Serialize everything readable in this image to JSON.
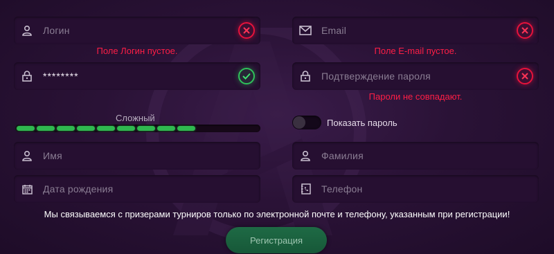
{
  "form": {
    "login": {
      "placeholder": "Логин",
      "error": "Поле Логин пустое."
    },
    "email": {
      "placeholder": "Email",
      "error": "Поле E-mail пустое."
    },
    "password": {
      "value": "********"
    },
    "password_confirm": {
      "placeholder": "Подтверждение пароля",
      "error": "Пароли не совпадают."
    },
    "strength": {
      "label": "Сложный",
      "filled_segments": 9,
      "level_fraction": 0.72
    },
    "show_password": {
      "label": "Показать пароль",
      "checked": false
    },
    "first_name": {
      "placeholder": "Имя"
    },
    "last_name": {
      "placeholder": "Фамилия"
    },
    "birth_date": {
      "placeholder": "Дата рождения"
    },
    "phone": {
      "placeholder": "Телефон"
    },
    "notice": "Мы связываемся с призерами турниров только по электронной почте и телефону, указанным при регистрации!",
    "submit_label": "Регистрация"
  },
  "colors": {
    "error": "#ff1e46",
    "success": "#2fc35a",
    "button": "#1e6a45"
  }
}
